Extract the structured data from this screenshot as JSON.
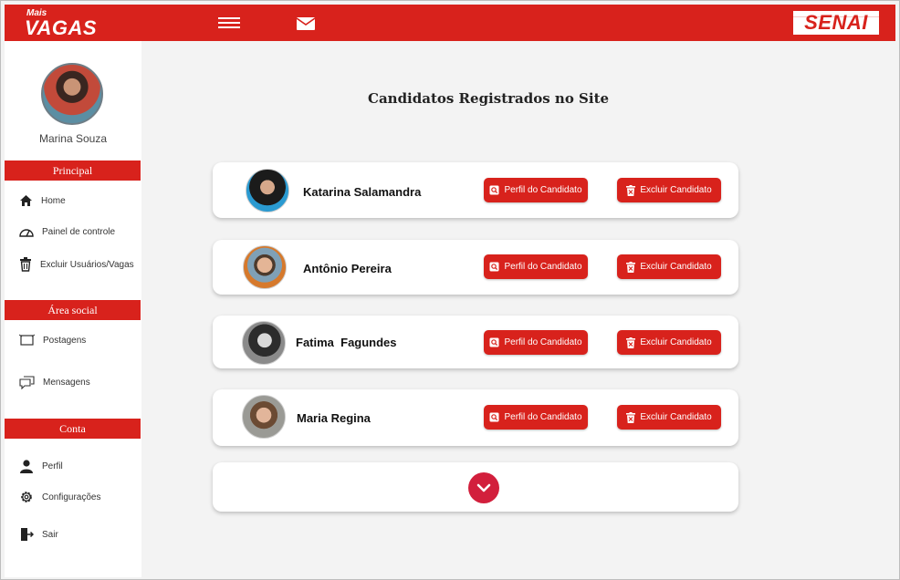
{
  "header": {
    "logo_small": "Mais",
    "logo_big": "VAGAS",
    "brand": "SENAI",
    "menu_icon": "hamburger-icon",
    "mail_icon": "mail-icon"
  },
  "sidebar": {
    "user_name": "Marina Souza",
    "sections": {
      "principal": "Principal",
      "social": "Área social",
      "conta": "Conta"
    },
    "items": [
      {
        "label": "Home",
        "icon": "home-icon"
      },
      {
        "label": "Painel de controle",
        "icon": "dashboard-icon"
      },
      {
        "label": "Excluir Usuários/Vagas",
        "icon": "trash-icon"
      },
      {
        "label": "Postagens",
        "icon": "posts-icon"
      },
      {
        "label": "Mensagens",
        "icon": "messages-icon"
      },
      {
        "label": "Perfil",
        "icon": "user-icon"
      },
      {
        "label": "Configurações",
        "icon": "gear-icon"
      },
      {
        "label": "Sair",
        "icon": "logout-icon"
      }
    ]
  },
  "main": {
    "title": "Candidatos Registrados no Site",
    "profile_button": "Perfil do Candidato",
    "delete_button": "Excluir Candidato",
    "candidates": [
      {
        "name": "Katarina Salamandra"
      },
      {
        "name": "Antônio Pereira"
      },
      {
        "name": "Fatima  Fagundes"
      },
      {
        "name": "Maria Regina"
      }
    ],
    "more_icon": "chevron-down-icon"
  },
  "colors": {
    "accent": "#d8221c",
    "more_button": "#d21f3c",
    "background": "#f3f3f3"
  }
}
